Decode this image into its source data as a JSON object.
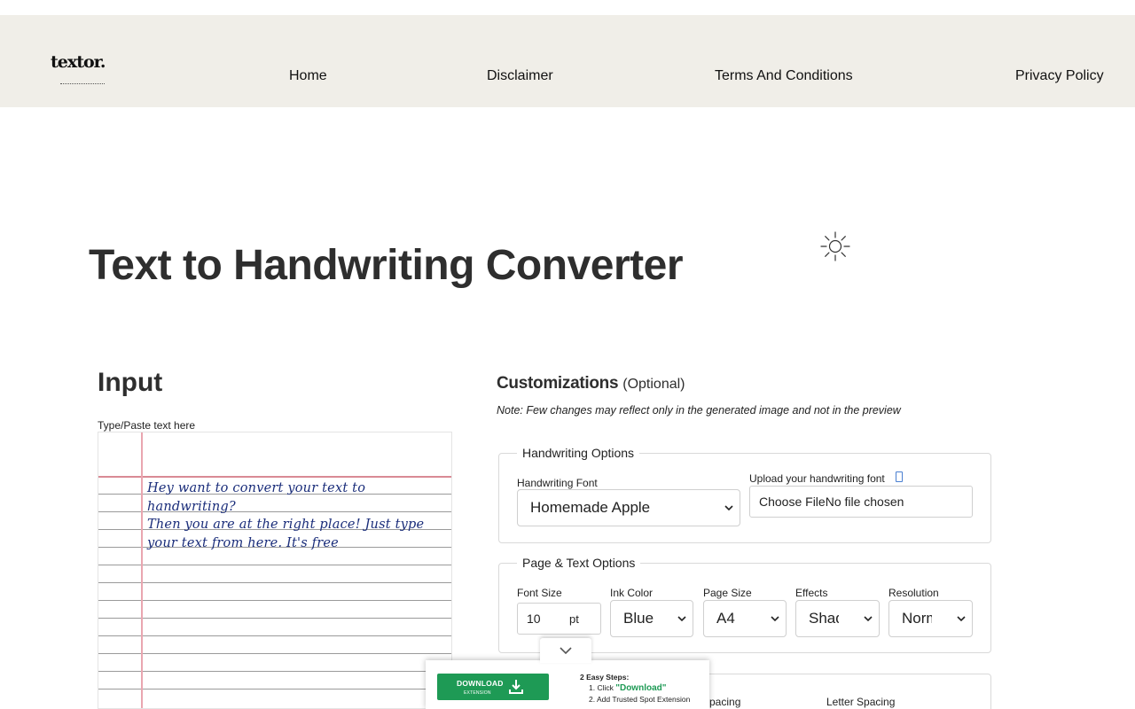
{
  "nav": {
    "logo": "textor.",
    "logo_sub": "converter",
    "links": [
      "Home",
      "Disclaimer",
      "Terms And Conditions",
      "Privacy Policy"
    ]
  },
  "page": {
    "title": "Text to Handwriting Converter",
    "theme_icon": "sun-icon"
  },
  "input": {
    "heading": "Input",
    "label": "Type/Paste text here",
    "text_lines": [
      "Hey want to convert your text to handwriting?",
      "Then you are at the right place! Just type",
      "your text from here. It's free"
    ]
  },
  "customizations": {
    "heading": "Customizations",
    "optional": "(Optional)",
    "note": "Note: Few changes may reflect only in the generated image and not in the preview",
    "handwriting_options": {
      "legend": "Handwriting Options",
      "font_label": "Handwriting Font",
      "font_value": "Homemade Apple",
      "upload_label": "Upload your handwriting font",
      "upload_value": "Choose FileNo file chosen"
    },
    "page_text_options": {
      "legend": "Page & Text Options",
      "font_size_label": "Font Size",
      "font_size_value": "10",
      "font_size_unit": "pt",
      "ink_color_label": "Ink Color",
      "ink_color_value": "Blue",
      "page_size_label": "Page Size",
      "page_size_value": "A4",
      "effects_label": "Effects",
      "effects_value": "Shadows",
      "resolution_label": "Resolution",
      "resolution_value": "Normal"
    },
    "spacing": {
      "word_spacing_partial": "pacing",
      "letter_spacing_label": "Letter Spacing"
    }
  },
  "ad": {
    "button_label": "DOWNLOAD",
    "button_sub": "EXTENSION",
    "steps_heading": "2 Easy Steps:",
    "step1_prefix": "1. Click ",
    "step1_highlight": "\"Download\"",
    "step2": "2. Add Trusted Spot Extension"
  },
  "colors": {
    "nav_bg": "#f0eee8",
    "ink": "#1a2d7a",
    "ad_green": "#1e9a55",
    "margin_line": "#e9a6b0"
  }
}
